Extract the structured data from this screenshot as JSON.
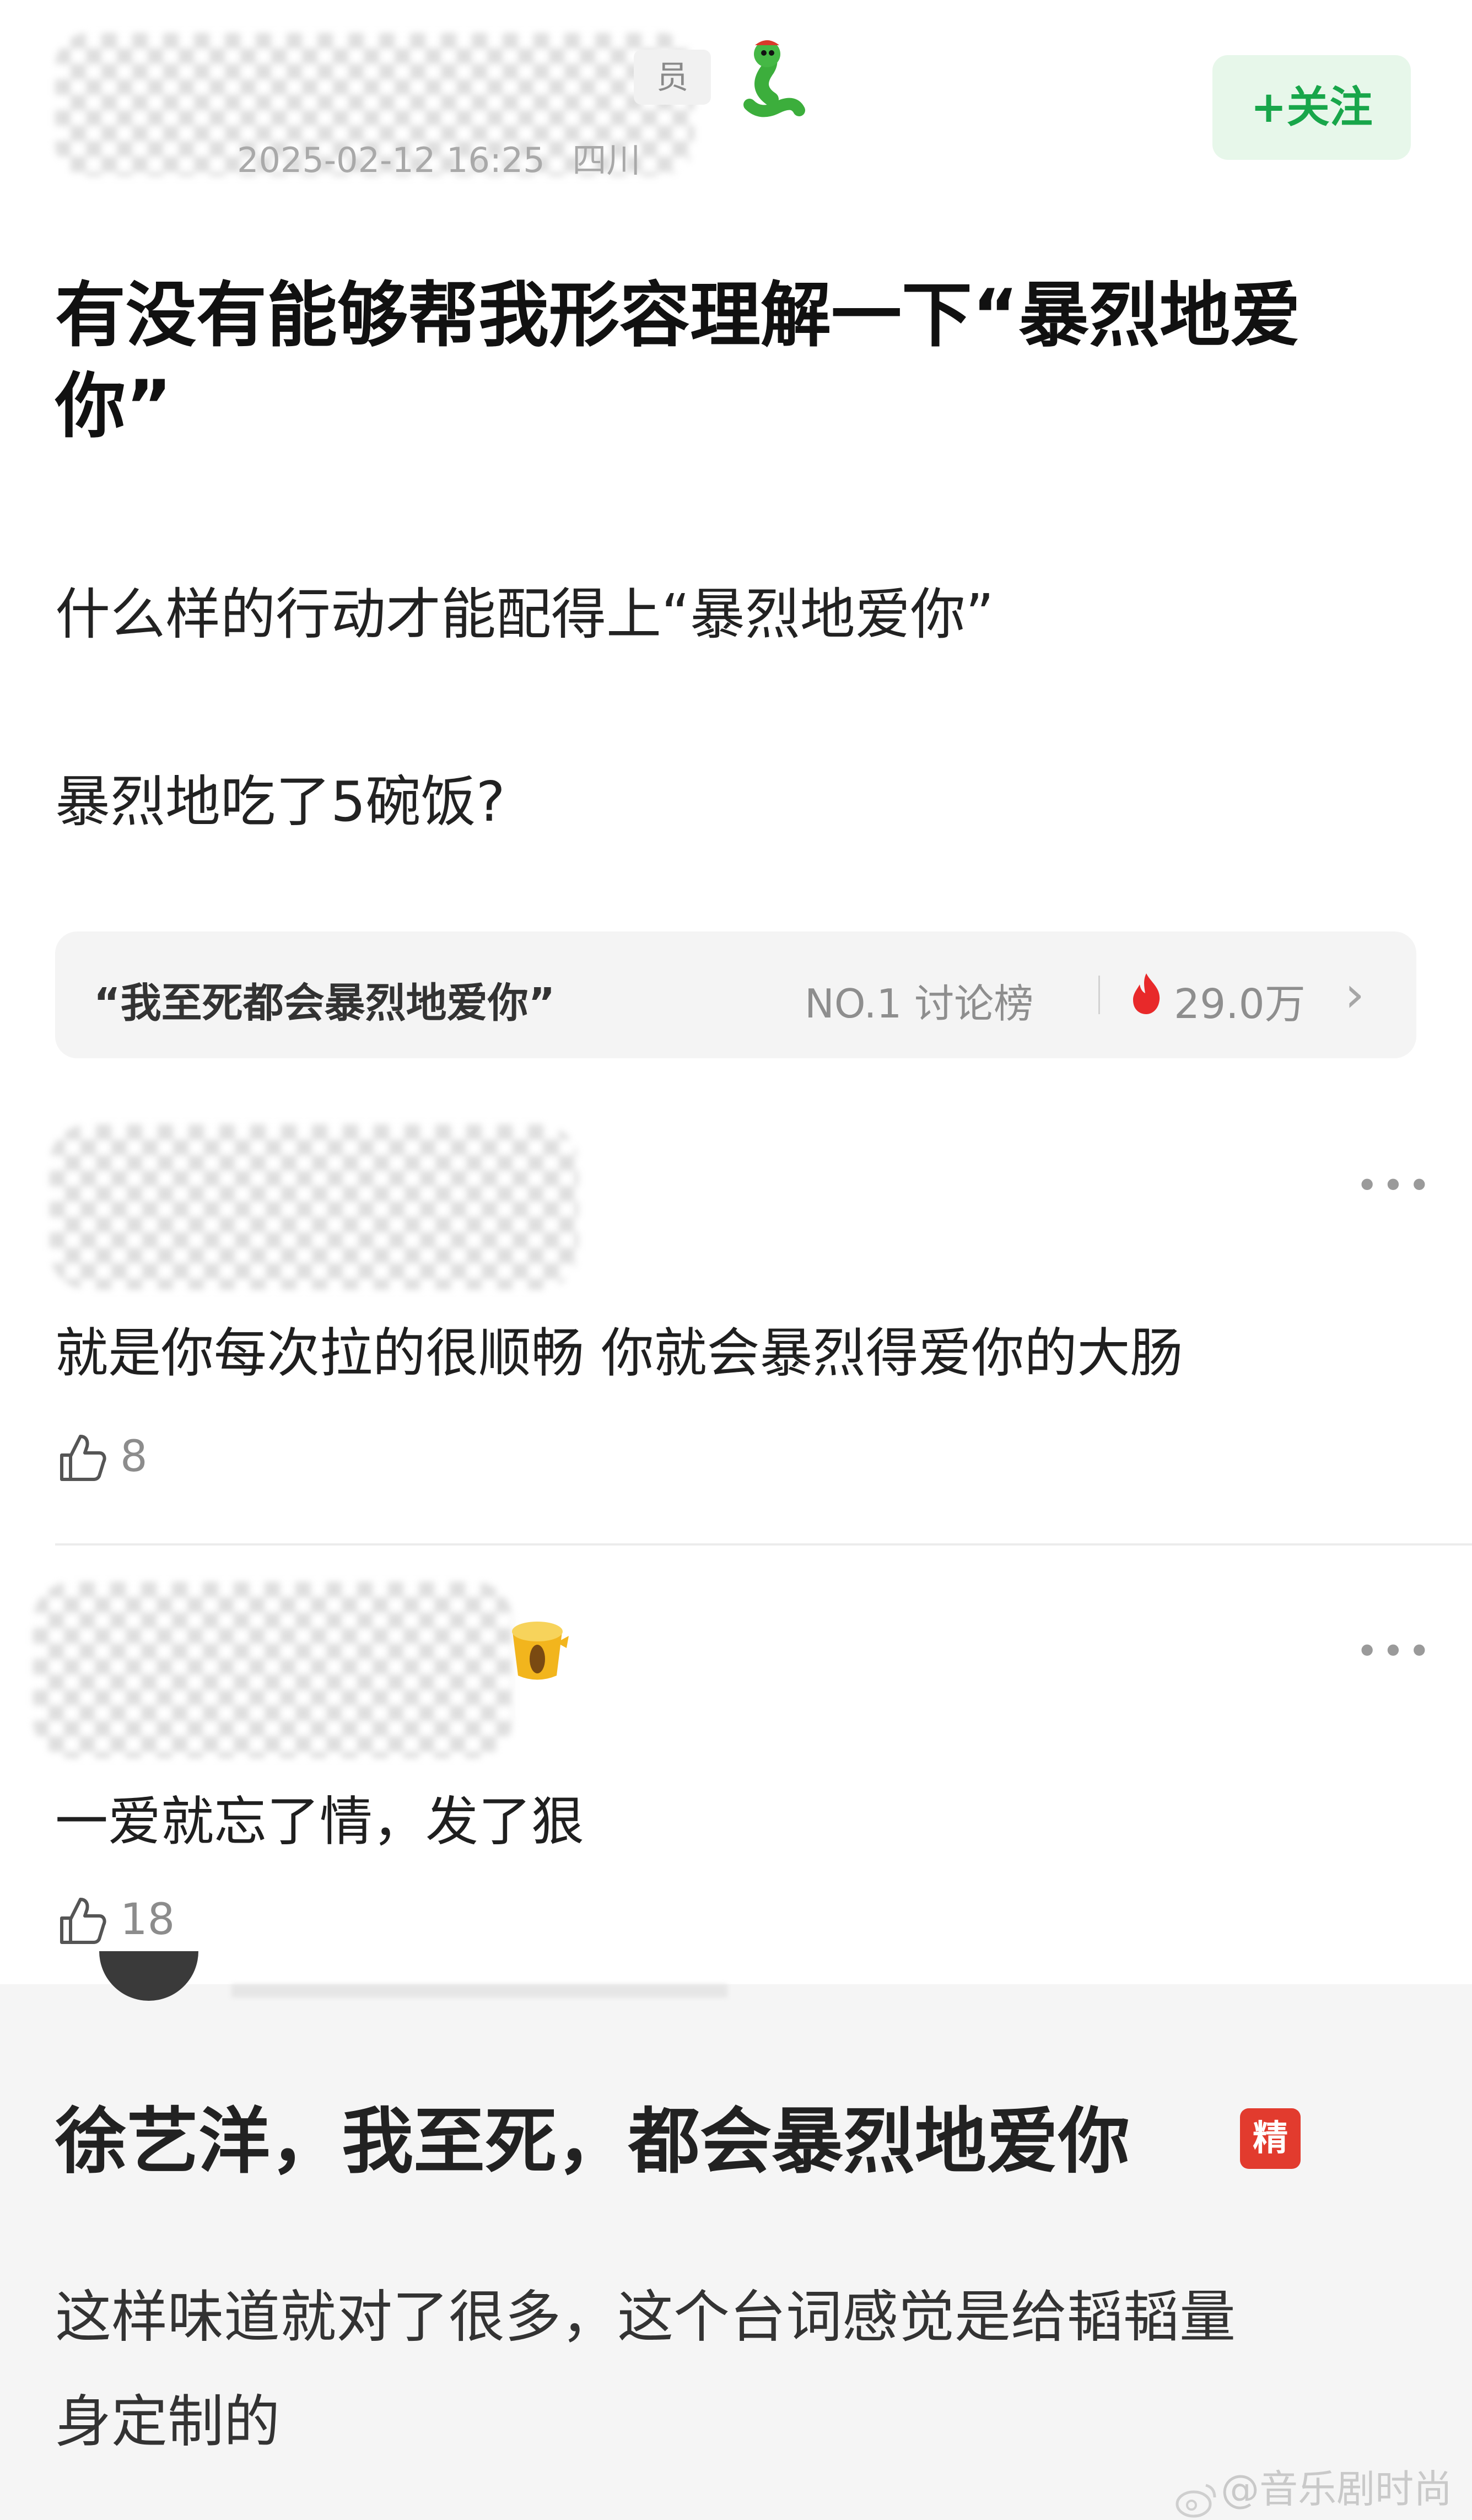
{
  "author": {
    "badge_tail": "员",
    "timestamp": "2025-02-12 16:25",
    "location": "四川",
    "follow_label": "关注",
    "follow_plus": "+"
  },
  "post": {
    "title": "有没有能够帮我形容理解一下“暴烈地爱你”",
    "paragraph1": "什么样的行动才能配得上“暴烈地爱你”",
    "paragraph2": "暴烈地吃了5碗饭?"
  },
  "hot_topic": {
    "quote": "“我至死都会暴烈地爱你”",
    "rank": "NO.1 讨论榜",
    "heat": "29.0万",
    "chevron": "›"
  },
  "comments": [
    {
      "text": "就是你每次拉的很顺畅 你就会暴烈得爱你的大肠",
      "likes": "8",
      "more": "•••"
    },
    {
      "text": "一爱就忘了情，发了狠",
      "likes": "18",
      "more": "•••"
    }
  ],
  "embedded_post": {
    "title": "徐艺洋，我至死，都会暴烈地爱你",
    "badge": "精",
    "body_line1": "这样味道就对了很多，这个台词感觉是给韬韬量",
    "body_line2": "身定制的"
  },
  "watermark": "@音乐剧时尚",
  "colors": {
    "accent_green": "#18a64a",
    "follow_bg": "#e7f7ea",
    "fire_red": "#e8292a",
    "jing_red": "#e23b2e"
  },
  "icons": [
    "snake-emoji-icon",
    "fire-icon",
    "chevron-right-icon",
    "more-icon",
    "thumbs-up-icon",
    "tree-stump-icon",
    "weibo-logo-icon"
  ]
}
